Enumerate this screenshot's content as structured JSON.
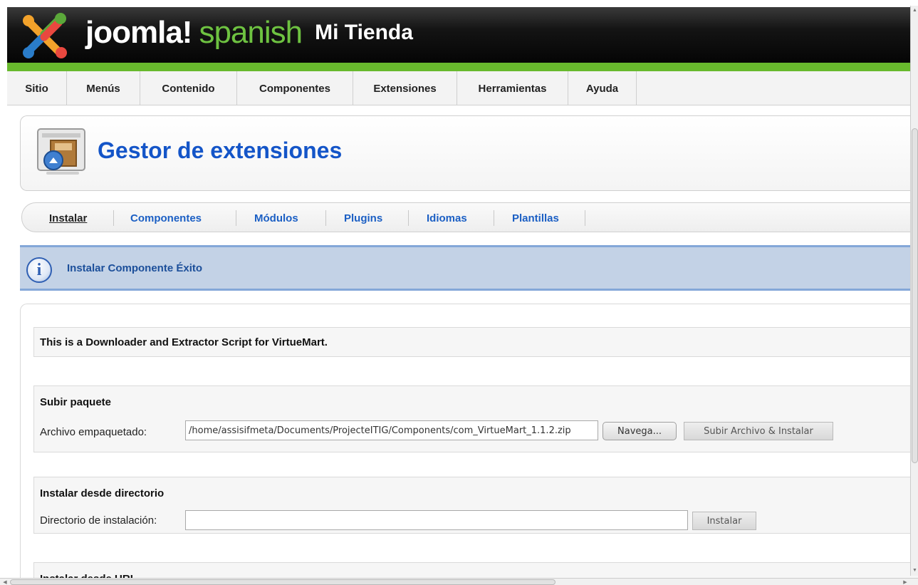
{
  "header": {
    "brand_main": "joomla!",
    "brand_sub": "spanish",
    "site_name": "Mi Tienda"
  },
  "menu": {
    "items": [
      "Sitio",
      "Menús",
      "Contenido",
      "Componentes",
      "Extensiones",
      "Herramientas",
      "Ayuda"
    ]
  },
  "page": {
    "title": "Gestor de extensiones"
  },
  "subnav": {
    "tabs": [
      "Instalar",
      "Componentes",
      "Módulos",
      "Plugins",
      "Idiomas",
      "Plantillas"
    ],
    "active": "Instalar"
  },
  "message": {
    "text": "Instalar Componente Éxito"
  },
  "content": {
    "script_note": "This is a Downloader and Extractor Script for VirtueMart.",
    "upload": {
      "title": "Subir paquete",
      "label": "Archivo empaquetado:",
      "value": "/home/assisifmeta/Documents/ProjecteITIG/Components/com_VirtueMart_1.1.2.zip",
      "browse_label": "Navega...",
      "submit_label": "Subir Archivo & Instalar"
    },
    "directory": {
      "title": "Instalar desde directorio",
      "label": "Directorio de instalación:",
      "value": "",
      "submit_label": "Instalar"
    },
    "url": {
      "title": "Instalar desde URL"
    }
  },
  "colors": {
    "accent_green": "#68b92d",
    "title_blue": "#1455c8",
    "message_bg": "#c3d2e6"
  },
  "icons": {
    "logo": "joomla-logo-icon",
    "page": "extension-manager-icon",
    "message": "info-icon"
  }
}
